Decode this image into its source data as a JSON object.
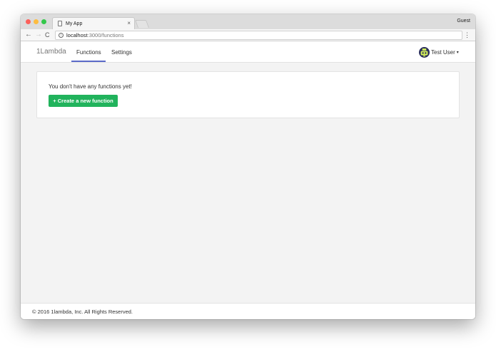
{
  "browser": {
    "tab_title": "My App",
    "tab_close": "×",
    "profile": "Guest",
    "url_host": "localhost",
    "url_path": ":3000/functions",
    "back": "←",
    "forward": "→",
    "reload": "C",
    "menu": "⋮",
    "info_glyph": "i",
    "icons": {
      "page": "page-icon",
      "info": "info-icon",
      "back": "arrow-left-icon",
      "forward": "arrow-right-icon",
      "reload": "reload-icon",
      "menu": "kebab-menu-icon"
    }
  },
  "navbar": {
    "brand": "1Lambda",
    "links": [
      {
        "label": "Functions",
        "active": true
      },
      {
        "label": "Settings",
        "active": false
      }
    ],
    "user": {
      "name": "Test User",
      "caret": "▾",
      "avatar_icon": "robot-avatar-icon"
    }
  },
  "main": {
    "empty_message": "You don't have any functions yet!",
    "create_button": "+ Create a new function"
  },
  "footer": {
    "copyright": "© 2016 1lambda, Inc. All Rights Reserved."
  },
  "colors": {
    "accent_underline": "#5b6ac8",
    "create_button": "#21b35c",
    "page_background": "#f3f3f3"
  }
}
